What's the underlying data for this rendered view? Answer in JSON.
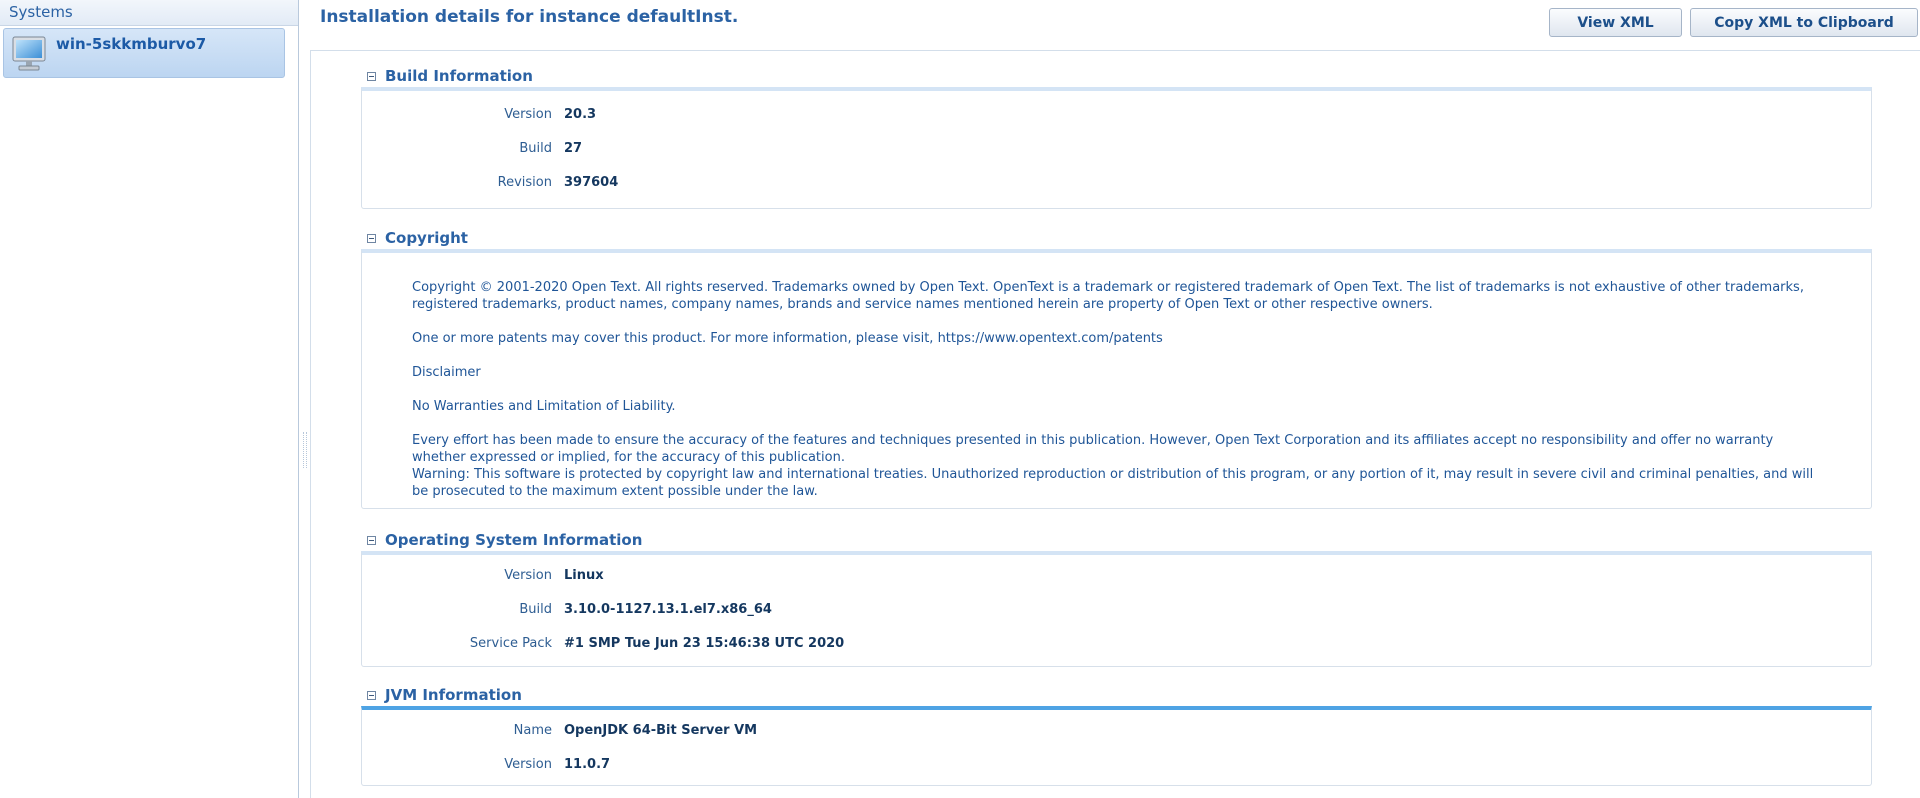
{
  "sidebar": {
    "header": "Systems",
    "items": [
      {
        "label": "win-5skkmburvo7",
        "icon": "monitor-icon"
      }
    ]
  },
  "main": {
    "title": "Installation details for instance defaultInst.",
    "buttons": {
      "view_xml": "View XML",
      "copy_xml": "Copy XML to Clipboard"
    },
    "sections": {
      "build": {
        "title": "Build Information",
        "fields": [
          {
            "label": "Version",
            "value": "20.3"
          },
          {
            "label": "Build",
            "value": "27"
          },
          {
            "label": "Revision",
            "value": "397604"
          }
        ]
      },
      "copyright": {
        "title": "Copyright",
        "paragraphs": [
          "Copyright © 2001-2020 Open Text. All rights reserved. Trademarks owned by Open Text. OpenText is a trademark or registered trademark of Open Text. The list of trademarks is not exhaustive of other trademarks, registered trademarks, product names, company names, brands and service names mentioned herein are property of Open Text or other respective owners.",
          "One or more patents may cover this product. For more information, please visit, https://www.opentext.com/patents",
          "Disclaimer",
          "No Warranties and Limitation of Liability.",
          "Every effort has been made to ensure the accuracy of the features and techniques presented in this publication. However, Open Text Corporation and its affiliates accept no responsibility and offer no warranty whether expressed or implied, for the accuracy of this publication.",
          "Warning: This software is protected by copyright law and international treaties. Unauthorized reproduction or distribution of this program, or any portion of it, may result in severe civil and criminal penalties, and will be prosecuted to the maximum extent possible under the law."
        ]
      },
      "os": {
        "title": "Operating System Information",
        "fields": [
          {
            "label": "Version",
            "value": "Linux"
          },
          {
            "label": "Build",
            "value": "3.10.0-1127.13.1.el7.x86_64"
          },
          {
            "label": "Service Pack",
            "value": "#1 SMP Tue Jun 23 15:46:38 UTC 2020"
          }
        ]
      },
      "jvm": {
        "title": "JVM Information",
        "fields": [
          {
            "label": "Name",
            "value": "OpenJDK 64-Bit Server VM"
          },
          {
            "label": "Version",
            "value": "11.0.7"
          }
        ]
      }
    }
  },
  "colors": {
    "accent": "#2b62a4",
    "selection": "#bcd5f1",
    "active_border": "#4ea3e4"
  }
}
